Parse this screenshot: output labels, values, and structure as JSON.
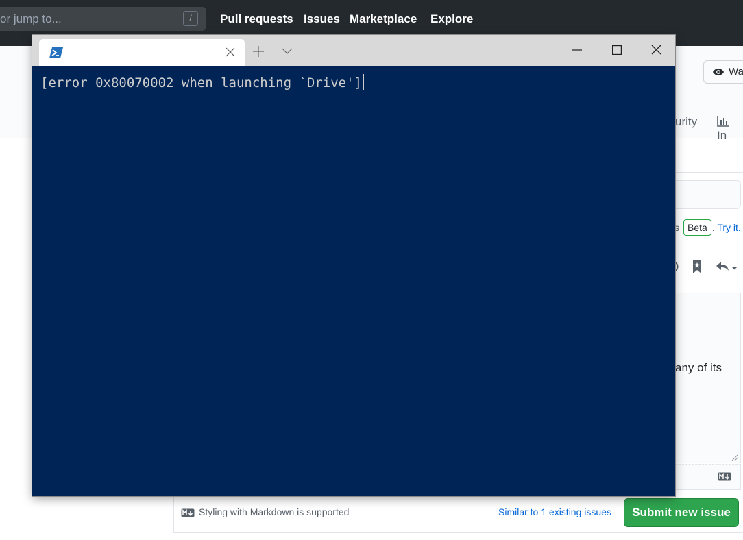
{
  "github": {
    "search_placeholder": "or jump to...",
    "search_shortcut": "/",
    "nav": [
      "Pull requests",
      "Issues",
      "Marketplace",
      "Explore"
    ],
    "watch_label": "Wa",
    "tab_security": "urity",
    "tab_insights": "In",
    "beta_prefix": "s",
    "beta_badge": "Beta",
    "beta_dot": ".",
    "try_it": "Try it.",
    "editor_visible_text": "any of its",
    "markdown_note": "Styling with Markdown is supported",
    "similar_issues": "Similar to 1 existing issues",
    "submit_label": "Submit new issue",
    "colors": {
      "header_bg": "#24292e",
      "submit_bg": "#2ea44f",
      "link": "#0366d6"
    }
  },
  "terminal": {
    "tab_icon": "powershell-icon",
    "output_line": "[error 0x80070002 when launching `Drive']",
    "colors": {
      "background": "#012456",
      "text": "#cccccc",
      "titlebar": "#d9d9d9"
    }
  }
}
